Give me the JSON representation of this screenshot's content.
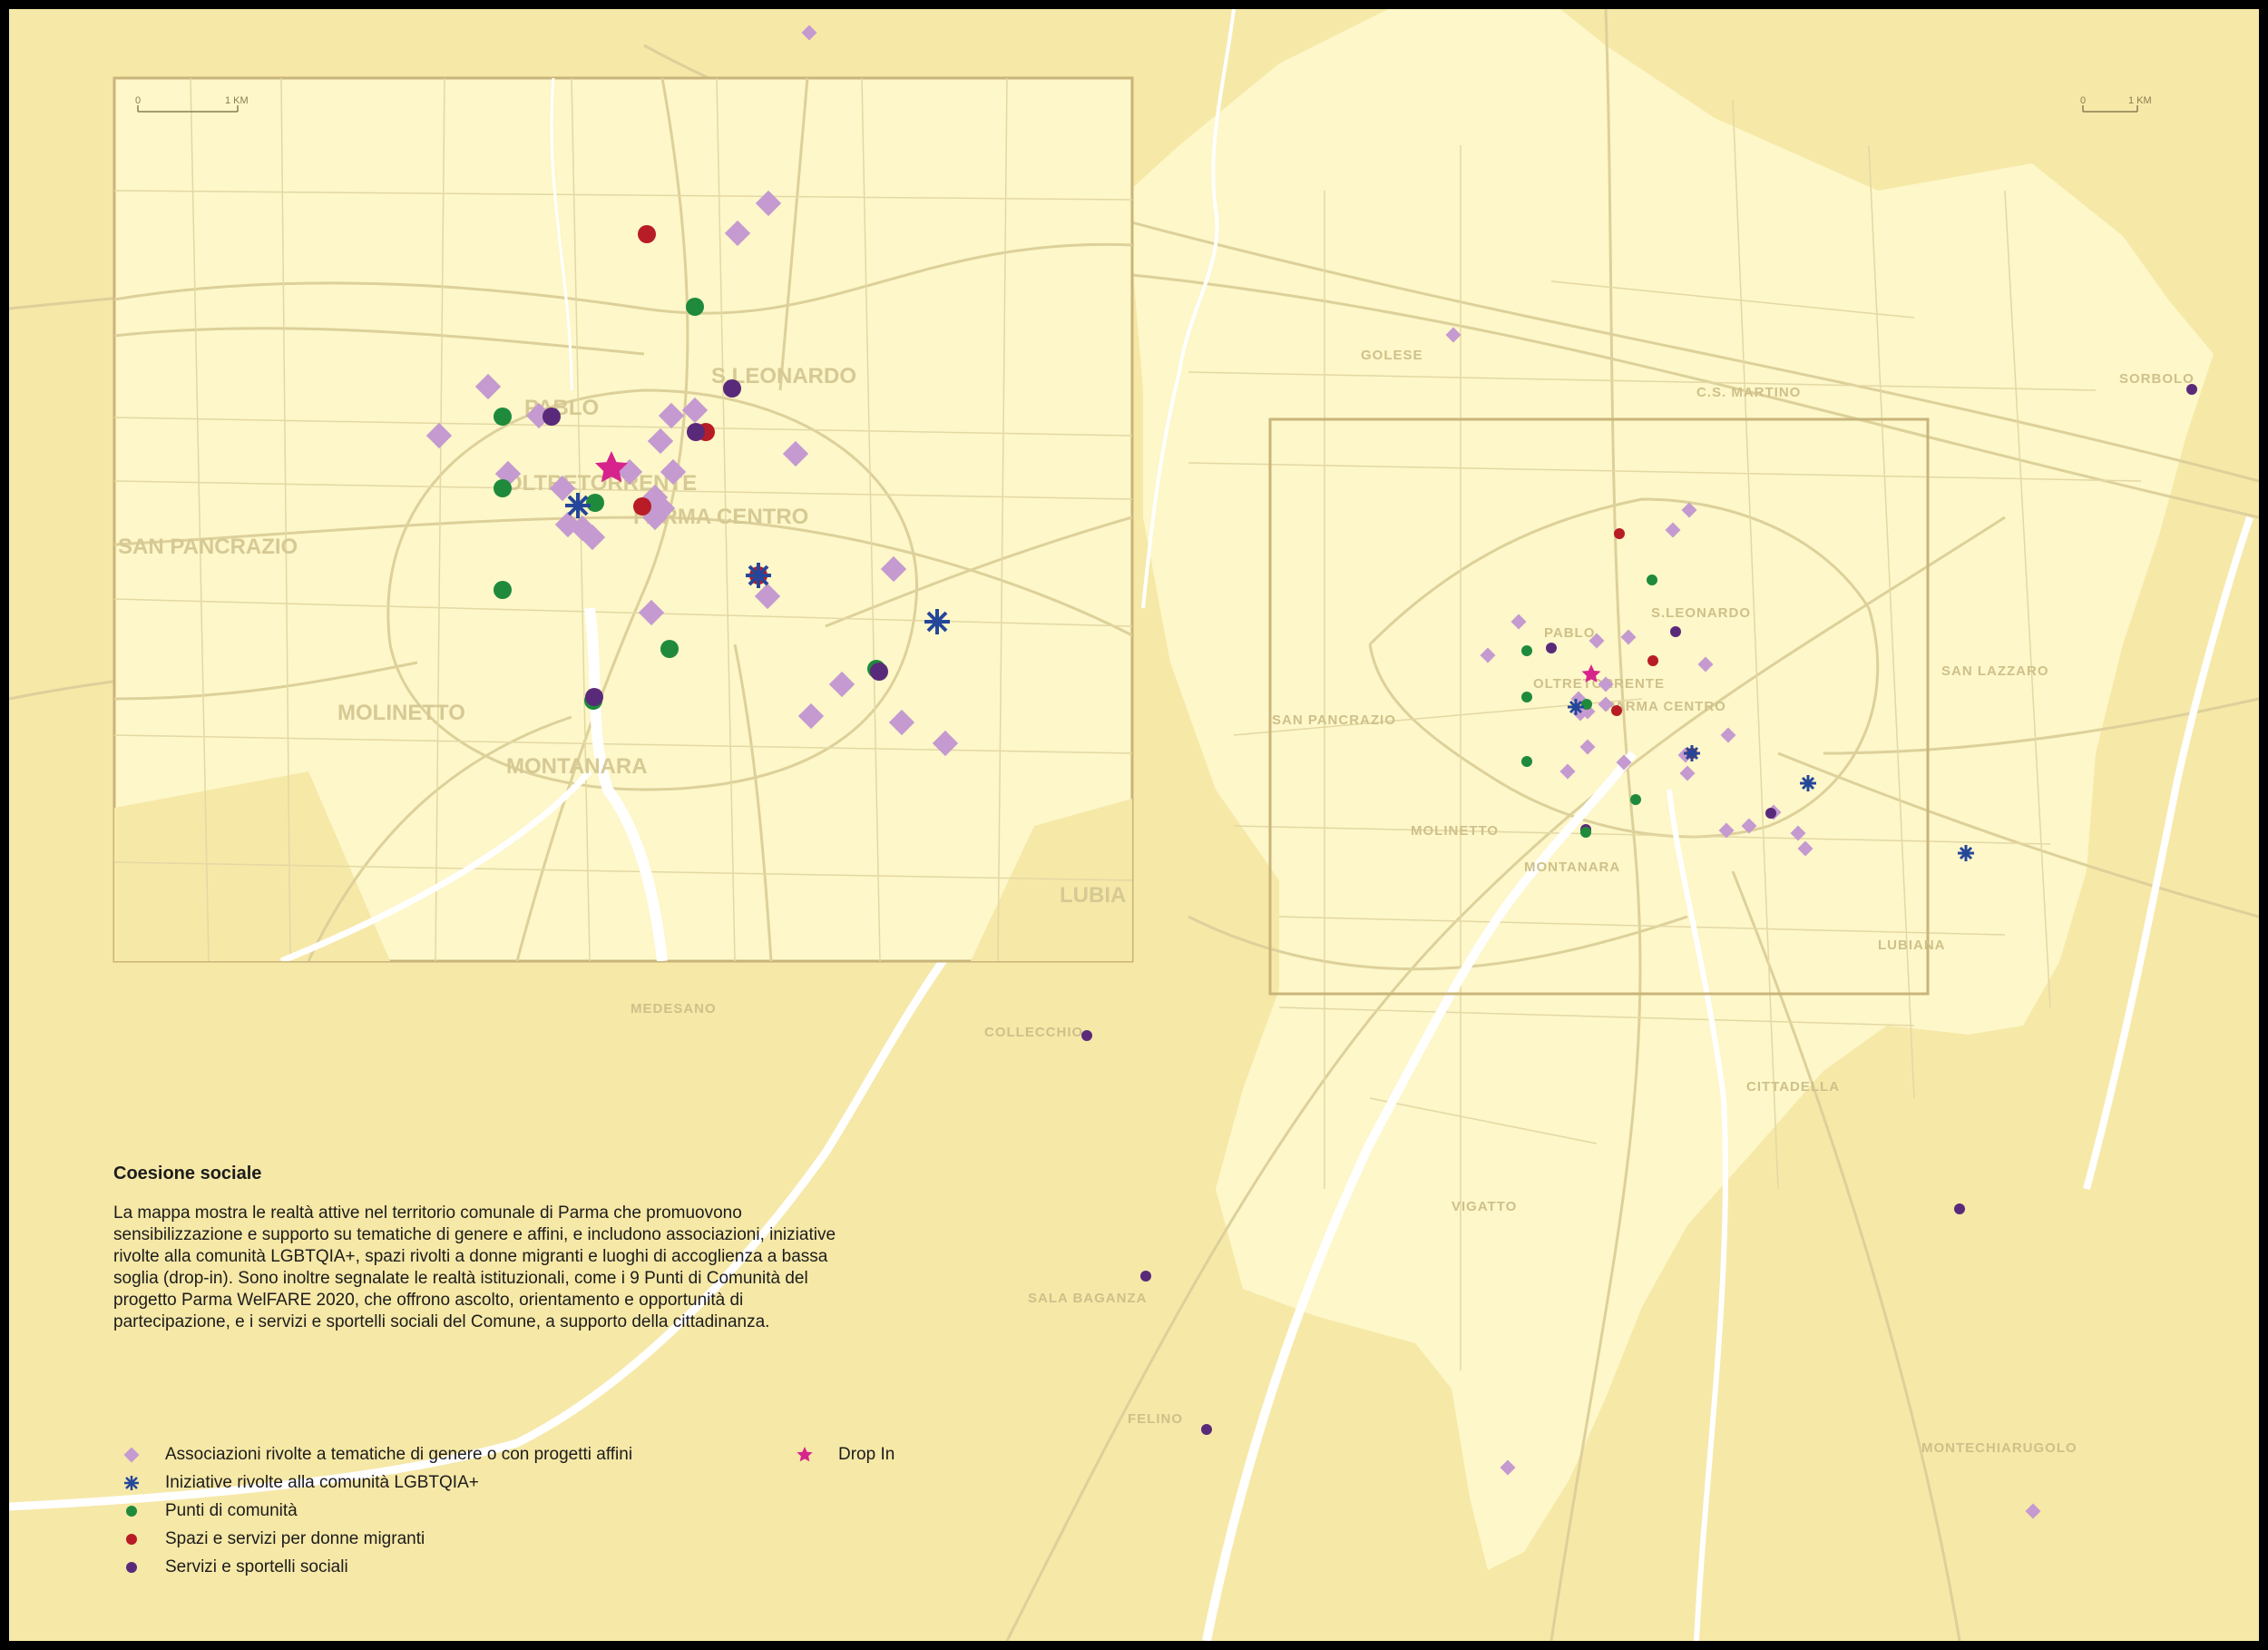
{
  "colors": {
    "background": "#f6e8a7",
    "municipality": "#fdf7c9",
    "road": "#ddd09a",
    "river": "#ffffff",
    "frame": "#c9b47a",
    "association": "#c49ad0",
    "lgbtqia": "#25479a",
    "community": "#1f8a3c",
    "migrant_women": "#b81c26",
    "social_services": "#5a2a7a",
    "drop_in": "#d6248c"
  },
  "scale_bars": [
    {
      "zero": "0",
      "unit": "1 KM"
    },
    {
      "zero": "0",
      "unit": "1 KM"
    }
  ],
  "inset_labels": [
    "PABLO",
    "S.LEONARDO",
    "OLTRETORRENTE",
    "PARMA CENTRO",
    "SAN PANCRAZIO",
    "MOLINETTO",
    "MONTANARA",
    "LUBIA"
  ],
  "main_labels": [
    "GOLESE",
    "C.S. MARTINO",
    "SORBOLO",
    "PABLO",
    "S.LEONARDO",
    "OLTRETORRENTE",
    "PARMA CENTRO",
    "SAN PANCRAZIO",
    "MOLINETTO",
    "MONTANARA",
    "SAN LAZZARO",
    "LUBIANA",
    "MEDESANO",
    "COLLECCHIO",
    "CITTADELLA",
    "VIGATTO",
    "SALA BAGANZA",
    "FELINO",
    "MONTECHIARUGOLO"
  ],
  "caption": {
    "title": "Coesione sociale",
    "body": "La mappa mostra le realtà attive nel territorio comunale di Parma che promuovono sensibilizzazione e supporto su tematiche di genere e affini, e includono associazioni, iniziative rivolte alla comunità LGBTQIA+, spazi rivolti a donne migranti e luoghi di accoglienza a bassa soglia (drop-in). Sono inoltre segnalate le realtà istituzionali, come i 9 Punti di Comunità del progetto Parma WelFARE 2020, che offrono ascolto, orientamento e opportunità di partecipazione, e i servizi e sportelli sociali del Comune, a supporto della cittadinanza."
  },
  "legend": [
    {
      "symbol": "diamond",
      "color": "#c49ad0",
      "label": "Associazioni rivolte a tematiche di genere o con progetti affini"
    },
    {
      "symbol": "asterisk",
      "color": "#25479a",
      "label": "Iniziative rivolte alla comunità LGBTQIA+"
    },
    {
      "symbol": "dot",
      "color": "#1f8a3c",
      "label": "Punti di comunità"
    },
    {
      "symbol": "dot",
      "color": "#b81c26",
      "label": "Spazi e servizi per donne migranti"
    },
    {
      "symbol": "dot",
      "color": "#5a2a7a",
      "label": "Servizi e sportelli sociali"
    },
    {
      "symbol": "star",
      "color": "#d6248c",
      "label": "Drop In"
    }
  ]
}
